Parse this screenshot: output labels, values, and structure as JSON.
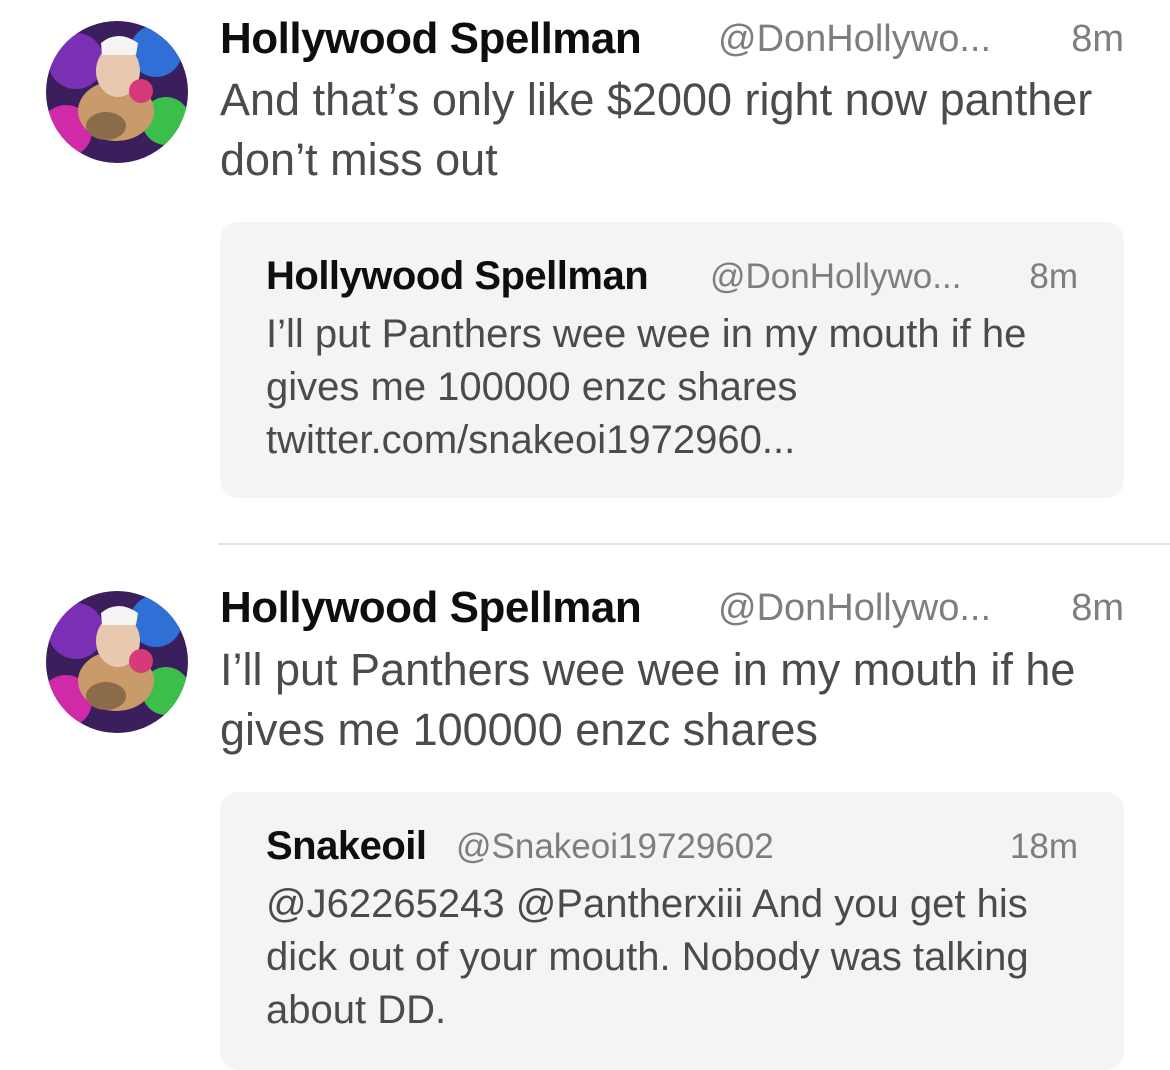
{
  "tweets": [
    {
      "name": "Hollywood Spellman",
      "handle": "@DonHollywo...",
      "time": "8m",
      "text": "And that’s only like $2000 right now panther don’t miss out",
      "avatar": "profile-photo-avatar",
      "quote": {
        "name": "Hollywood Spellman",
        "handle": "@DonHollywo...",
        "time": "8m",
        "text": "I’ll put Panthers wee wee in my mouth if he gives me 100000 enzc shares twitter.com/snakeoi1972960..."
      }
    },
    {
      "name": "Hollywood Spellman",
      "handle": "@DonHollywo...",
      "time": "8m",
      "text": "I’ll put Panthers wee wee in my mouth if he gives me 100000 enzc shares",
      "avatar": "profile-photo-avatar",
      "quote": {
        "name": "Snakeoil",
        "handle": "@Snakeoi19729602",
        "time": "18m",
        "text": "@J62265243 @Pantherxiii And you get his dick out of your mouth. Nobody was talking about DD."
      }
    }
  ],
  "colors": {
    "background": "#ffffff",
    "quote_background": "#f4f4f5",
    "name": "#0e0e0e",
    "secondary_text": "#7d7d82",
    "body_text": "#4a4a4f",
    "divider": "#e3e3e6"
  }
}
